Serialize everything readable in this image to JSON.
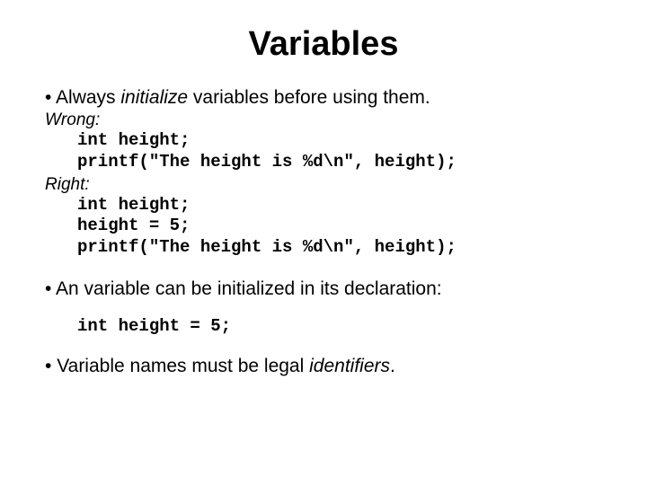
{
  "title": "Variables",
  "b1": {
    "pre": "Always ",
    "em": "initialize",
    "post": " variables before using them."
  },
  "wrong": {
    "label": "Wrong:",
    "code": "int height;\nprintf(\"The height is %d\\n\", height);"
  },
  "right": {
    "label": "Right:",
    "code": "int height;\nheight = 5;\nprintf(\"The height is %d\\n\", height);"
  },
  "b2": "An variable can be initialized in its declaration:",
  "code2": "int height = 5;",
  "b3": {
    "pre": "Variable names must be legal ",
    "em": "identifiers",
    "post": "."
  }
}
